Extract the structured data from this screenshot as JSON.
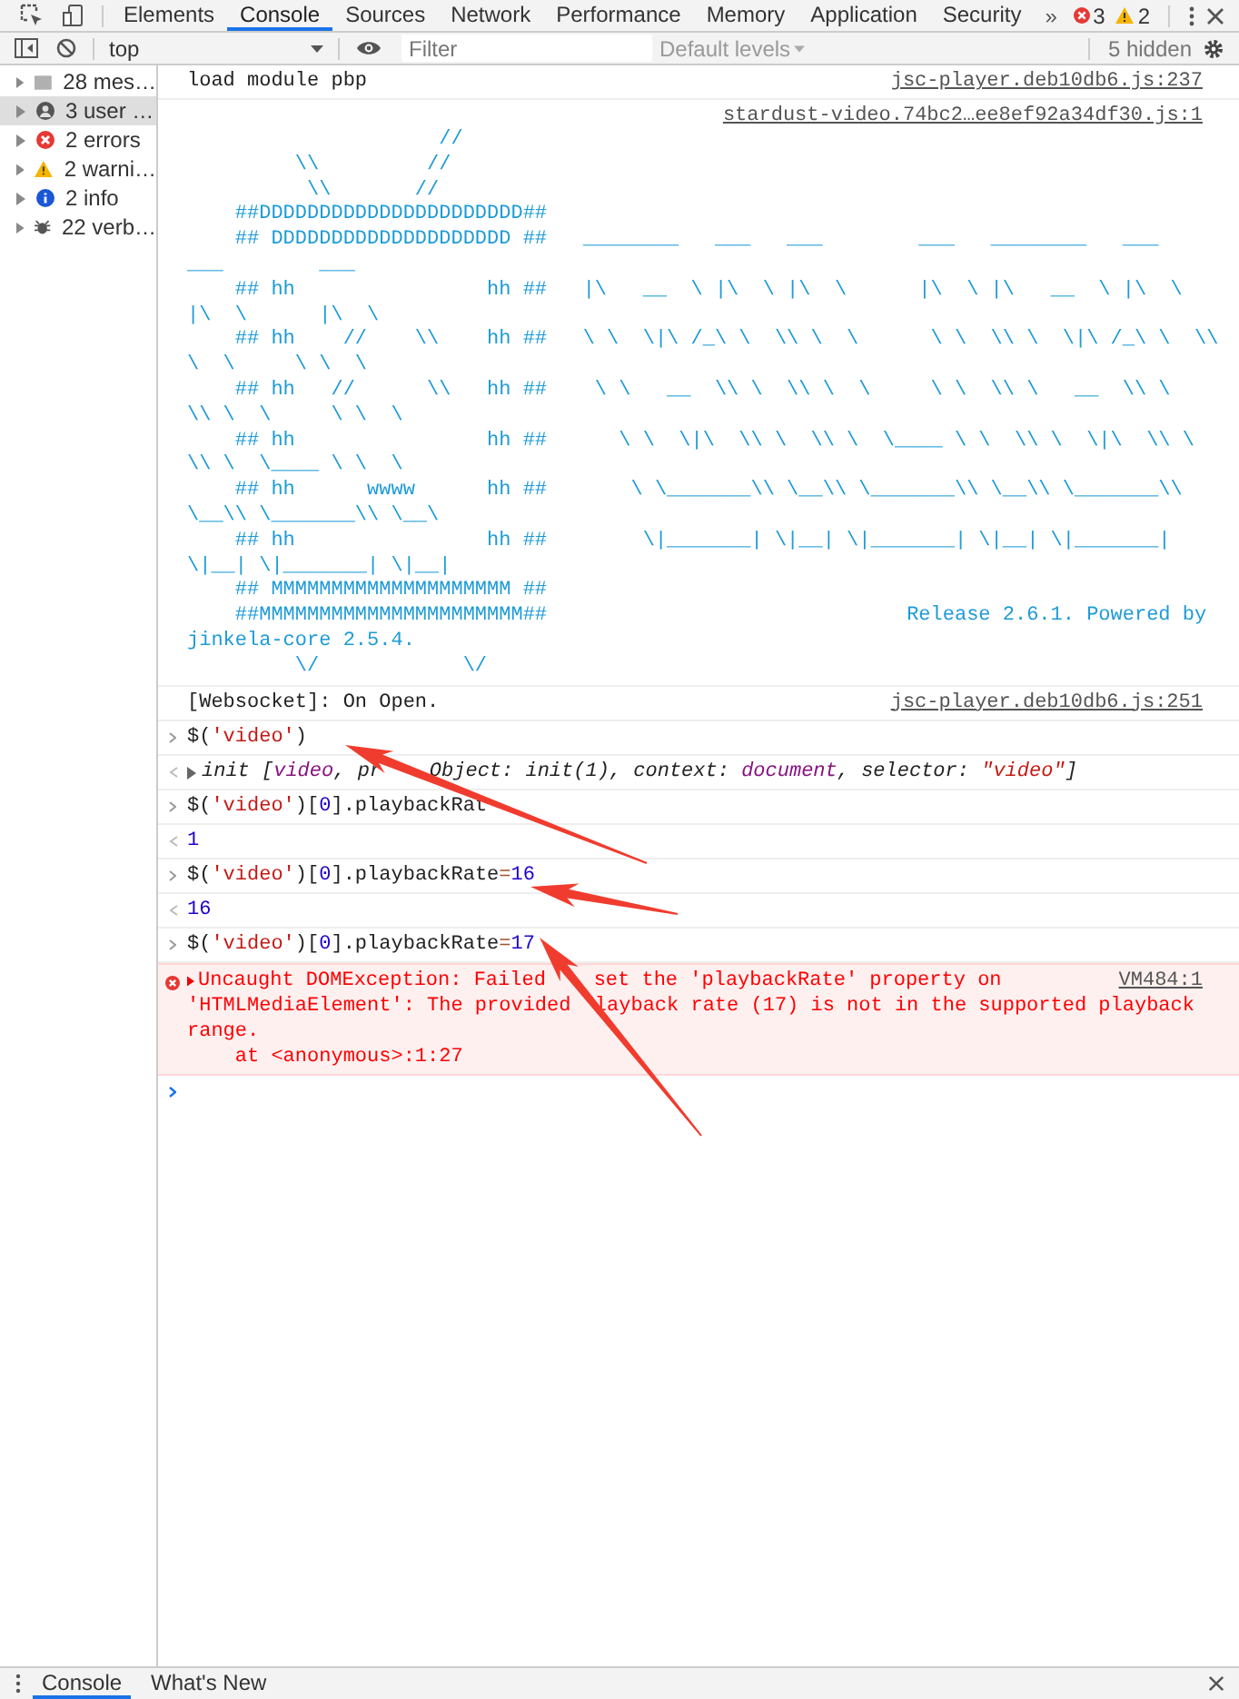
{
  "tabs": [
    {
      "label": "Elements",
      "selected": false
    },
    {
      "label": "Console",
      "selected": true
    },
    {
      "label": "Sources",
      "selected": false
    },
    {
      "label": "Network",
      "selected": false
    },
    {
      "label": "Performance",
      "selected": false
    },
    {
      "label": "Memory",
      "selected": false
    },
    {
      "label": "Application",
      "selected": false
    },
    {
      "label": "Security",
      "selected": false
    }
  ],
  "more_tabs": "»",
  "error_count": "3",
  "warning_count": "2",
  "toolbar": {
    "context": "top",
    "filter_placeholder": "Filter",
    "levels": "Default levels",
    "hidden": "5 hidden"
  },
  "sidebar": {
    "items": [
      {
        "kind": "list",
        "label": "28 mes…",
        "selected": false
      },
      {
        "kind": "user",
        "label": "3 user …",
        "selected": true
      },
      {
        "kind": "error",
        "label": "2 errors",
        "selected": false
      },
      {
        "kind": "warning",
        "label": "2 warni…",
        "selected": false
      },
      {
        "kind": "info",
        "label": "2 info",
        "selected": false
      },
      {
        "kind": "verbose",
        "label": "22 verb…",
        "selected": false
      }
    ]
  },
  "messages": [
    {
      "kind": "log",
      "text": "load module pbp",
      "source": "jsc-player.deb10db6.js:237"
    },
    {
      "kind": "banner",
      "source": "stardust-video.74bc2…ee8ef92a34df30.js:1",
      "lines": [
        "                     //",
        "         \\\\         //",
        "          \\\\       //",
        "    ##DDDDDDDDDDDDDDDDDDDDDD##",
        "    ## DDDDDDDDDDDDDDDDDDDD ##   ________   ___   ___        ___   ________   ___",
        "___        ___",
        "    ## hh                hh ##   |\\   __  \\ |\\  \\ |\\  \\      |\\  \\ |\\   __  \\ |\\  \\",
        "|\\  \\      |\\  \\",
        "    ## hh    //    \\\\    hh ##   \\ \\  \\|\\ /_\\ \\  \\\\ \\  \\      \\ \\  \\\\ \\  \\|\\ /_\\ \\  \\\\",
        "\\  \\     \\ \\  \\",
        "    ## hh   //      \\\\   hh ##    \\ \\   __  \\\\ \\  \\\\ \\  \\     \\ \\  \\\\ \\   __  \\\\ \\",
        "\\\\ \\  \\     \\ \\  \\",
        "    ## hh                hh ##      \\ \\  \\|\\  \\\\ \\  \\\\ \\  \\____ \\ \\  \\\\ \\  \\|\\  \\\\ \\",
        "\\\\ \\  \\____ \\ \\  \\",
        "    ## hh      wwww      hh ##       \\ \\_______\\\\ \\__\\\\ \\_______\\\\ \\__\\\\ \\_______\\\\",
        "\\__\\\\ \\_______\\\\ \\__\\",
        "    ## hh                hh ##        \\|_______| \\|__| \\|_______| \\|__| \\|_______|",
        "\\|__| \\|_______| \\|__|",
        "    ## MMMMMMMMMMMMMMMMMMMM ##",
        "    ##MMMMMMMMMMMMMMMMMMMMMM##                              Release 2.6.1. Powered by",
        "jinkela-core 2.5.4.",
        "         \\/            \\/"
      ]
    },
    {
      "kind": "log",
      "text": "[Websocket]: On Open.",
      "source": "jsc-player.deb10db6.js:251"
    },
    {
      "kind": "input",
      "tokens": [
        {
          "kind": "plain",
          "text": "$("
        },
        {
          "kind": "string",
          "text": "'video'"
        },
        {
          "kind": "plain",
          "text": ")"
        }
      ]
    },
    {
      "kind": "result",
      "expandable": true,
      "tokens": [
        {
          "kind": "plain",
          "text": "init ["
        },
        {
          "kind": "keyword",
          "text": "video"
        },
        {
          "kind": "plain",
          "text": ", pr",
          "gap_after": true
        },
        {
          "kind": "plain",
          "text": "Object: init(1), context: "
        },
        {
          "kind": "keyword",
          "text": "document"
        },
        {
          "kind": "plain",
          "text": ", selector: "
        },
        {
          "kind": "string",
          "text": "\"video\""
        },
        {
          "kind": "plain",
          "text": "]"
        }
      ]
    },
    {
      "kind": "input",
      "tokens": [
        {
          "kind": "plain",
          "text": "$("
        },
        {
          "kind": "string",
          "text": "'video'"
        },
        {
          "kind": "plain",
          "text": ")["
        },
        {
          "kind": "number",
          "text": "0"
        },
        {
          "kind": "plain",
          "text": "].playbackRat",
          "gap_after": true
        }
      ]
    },
    {
      "kind": "result",
      "expandable": false,
      "tokens": [
        {
          "kind": "number",
          "text": "1"
        }
      ]
    },
    {
      "kind": "input",
      "tokens": [
        {
          "kind": "plain",
          "text": "$("
        },
        {
          "kind": "string",
          "text": "'video'"
        },
        {
          "kind": "plain",
          "text": ")["
        },
        {
          "kind": "number",
          "text": "0"
        },
        {
          "kind": "plain",
          "text": "].playbackRate"
        },
        {
          "kind": "operator",
          "text": "="
        },
        {
          "kind": "number",
          "text": "16"
        }
      ]
    },
    {
      "kind": "result",
      "expandable": false,
      "tokens": [
        {
          "kind": "number",
          "text": "16"
        }
      ]
    },
    {
      "kind": "input",
      "tokens": [
        {
          "kind": "plain",
          "text": "$("
        },
        {
          "kind": "string",
          "text": "'video'"
        },
        {
          "kind": "plain",
          "text": ")["
        },
        {
          "kind": "number",
          "text": "0"
        },
        {
          "kind": "plain",
          "text": "].playbackRate"
        },
        {
          "kind": "operator",
          "text": "="
        },
        {
          "kind": "number",
          "text": "17"
        }
      ]
    },
    {
      "kind": "error",
      "expandable": true,
      "source": "VM484:1",
      "lines": [
        [
          "Uncaught DOMException: Failed",
          "set the 'playbackRate' property on"
        ],
        [
          "'HTMLMediaElement': The provided",
          "layback rate (17) is not in the supported playback"
        ],
        [
          "range."
        ],
        [
          "    at <anonymous>:1:27"
        ]
      ]
    },
    {
      "kind": "prompt"
    }
  ],
  "drawer": {
    "tabs": [
      {
        "label": "Console",
        "selected": true
      },
      {
        "label": "What's New",
        "selected": false
      }
    ]
  }
}
